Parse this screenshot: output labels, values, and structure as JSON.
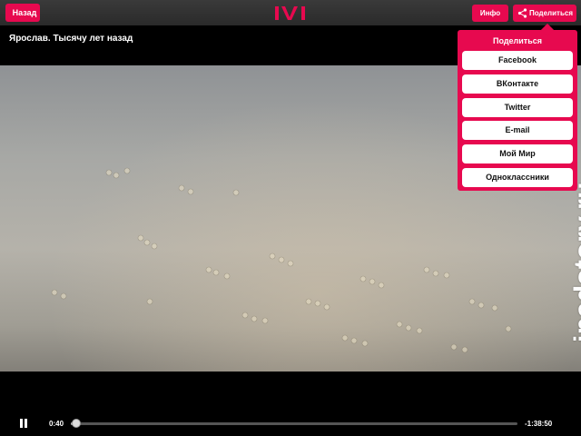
{
  "header": {
    "back_label": "Назад",
    "logo_text": "ivi",
    "info_label": "Инфо",
    "share_label": "Поделиться"
  },
  "video": {
    "title": "Ярослав. Тысячу лет назад",
    "watermark": "ipadstory.ru"
  },
  "share_menu": {
    "title": "Поделиться",
    "items": [
      {
        "label": "Facebook"
      },
      {
        "label": "ВКонтакте"
      },
      {
        "label": "Twitter"
      },
      {
        "label": "E-mail"
      },
      {
        "label": "Мой Мир"
      },
      {
        "label": "Одноклассники"
      }
    ]
  },
  "player": {
    "elapsed": "0:40",
    "remaining": "-1:38:50",
    "progress_fraction": 0.007
  },
  "colors": {
    "accent": "#e7094f",
    "topbar": "#2f2f2f",
    "background": "#000000"
  },
  "icons": {
    "back": "chevron-left-icon",
    "share": "share-icon",
    "pause": "pause-icon"
  }
}
